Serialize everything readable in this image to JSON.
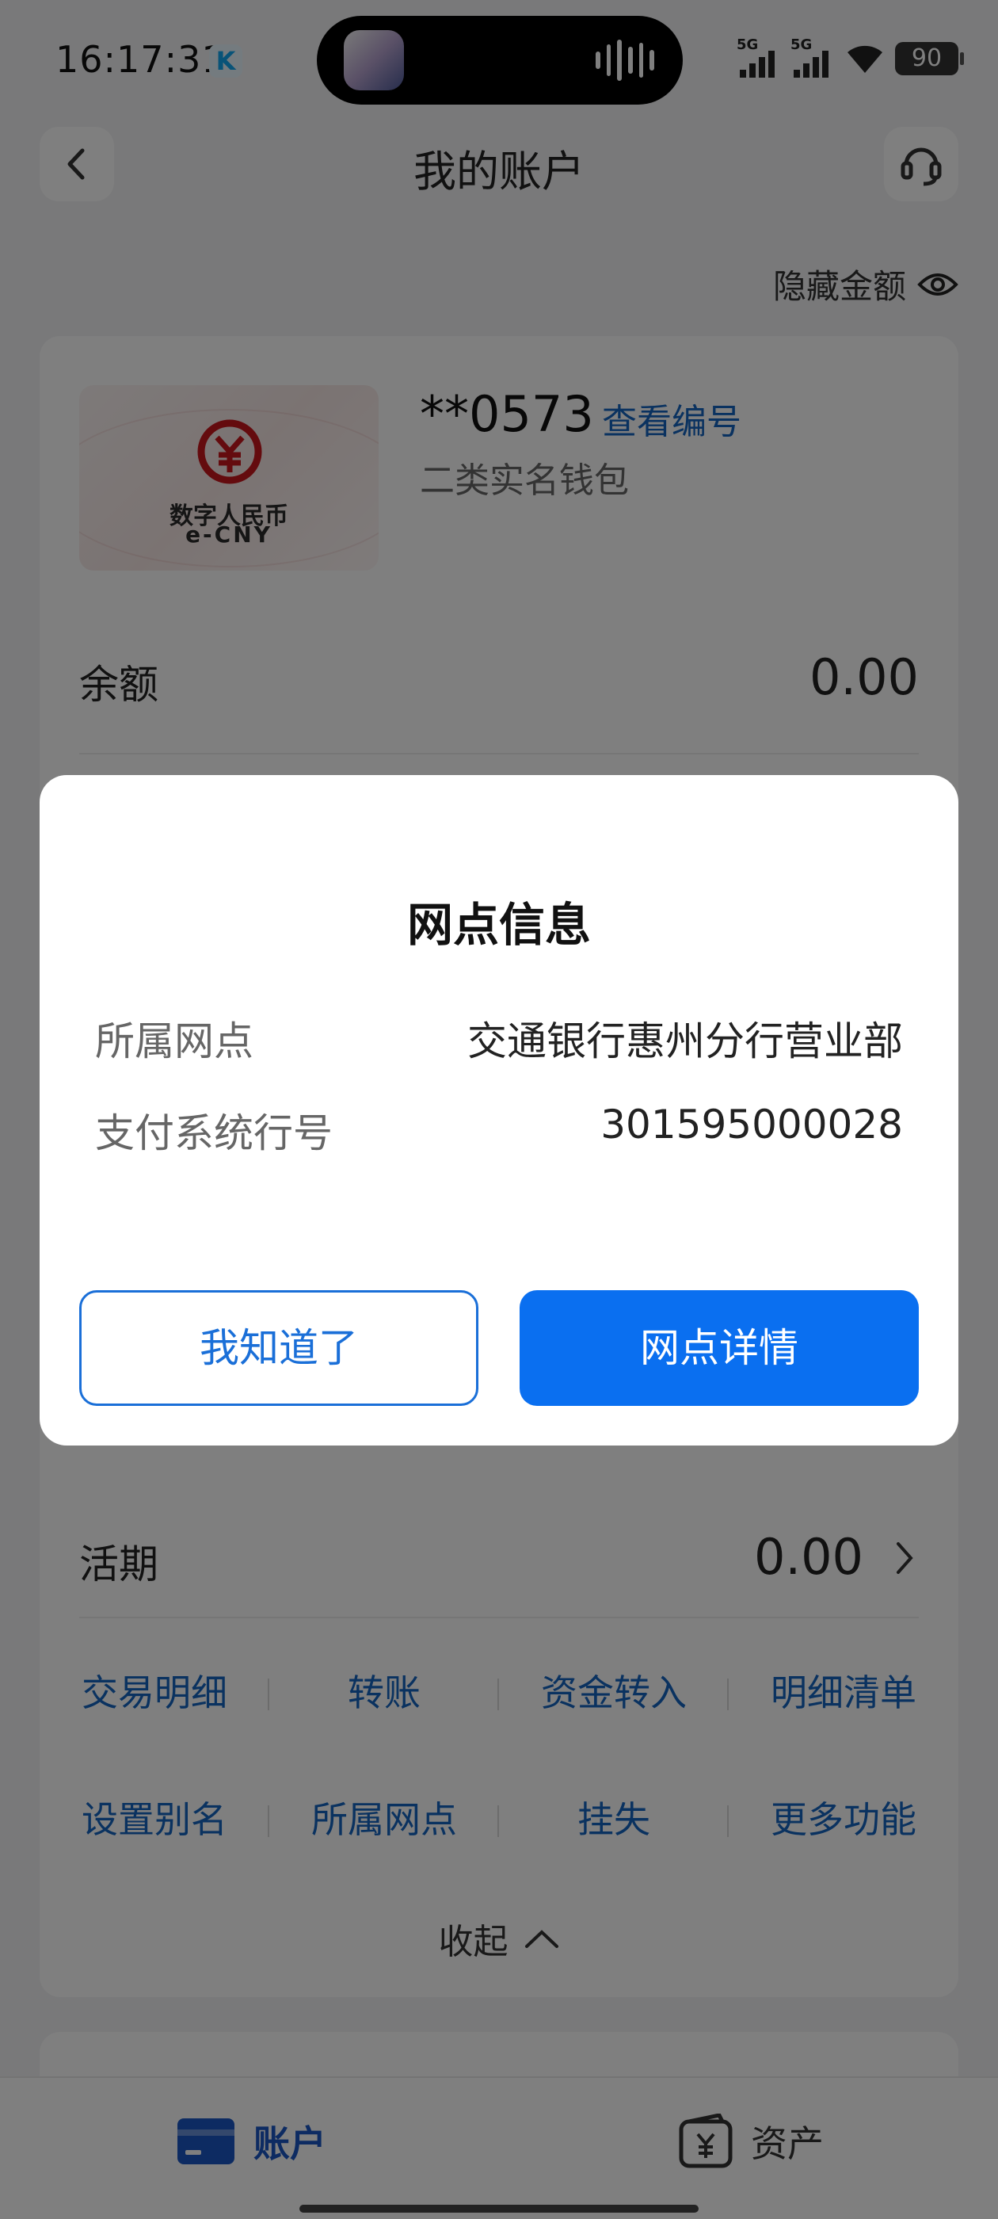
{
  "status_bar": {
    "time": "16:17:31",
    "net1": "5G",
    "net2": "5G",
    "battery": "90"
  },
  "header": {
    "title": "我的账户"
  },
  "hide_amount_label": "隐藏金额",
  "account": {
    "card_logo_cn": "数字人民币",
    "card_logo_en": "e-CNY",
    "number": "**0573",
    "view_number": "查看编号",
    "wallet_type": "二类实名钱包",
    "balance_label": "余额",
    "balance_value": "0.00",
    "current_label": "活期",
    "current_value": "0.00"
  },
  "actions": {
    "row1": [
      "交易明细",
      "转账",
      "资金转入",
      "明细清单"
    ],
    "row2": [
      "设置别名",
      "所属网点",
      "挂失",
      "更多功能"
    ]
  },
  "collapse_label": "收起",
  "tabs": {
    "accounts": "账户",
    "assets": "资产"
  },
  "dialog": {
    "title": "网点信息",
    "branch_label": "所属网点",
    "branch_value": "交通银行惠州分行营业部",
    "code_label": "支付系统行号",
    "code_value": "301595000028",
    "ok_button": "我知道了",
    "detail_button": "网点详情"
  },
  "colors": {
    "accent": "#0a6ff0",
    "link": "#1565c0",
    "ecny_red": "#c8161d"
  }
}
